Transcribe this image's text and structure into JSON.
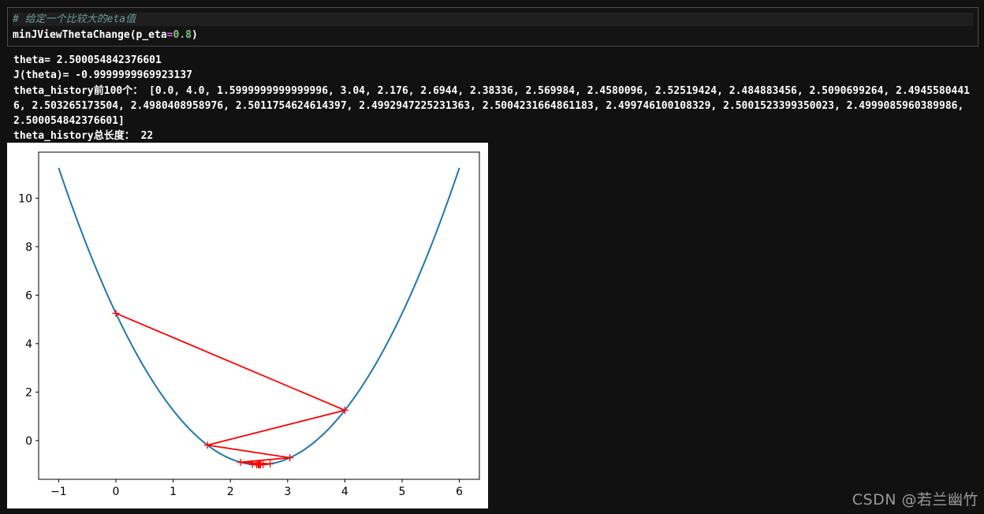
{
  "cell": {
    "comment": "# 给定一个比较大的eta值",
    "code_prefix": "minJViewThetaChange(p_eta",
    "code_operator": "=",
    "code_value": "0.8",
    "code_suffix": ")"
  },
  "output": {
    "theta_line": "theta= 2.500054842376601",
    "j_line": "J(theta)= -0.9999999969923137",
    "history_line": "theta_history前100个： [0.0, 4.0, 1.5999999999999996, 3.04, 2.176, 2.6944, 2.38336, 2.569984, 2.4580096, 2.52519424, 2.484883456, 2.5090699264, 2.49455804416, 2.503265173504, 2.4980408958976, 2.5011754624614397, 2.4992947225231363, 2.5004231664861183, 2.499746100108329, 2.5001523399350023, 2.4999085960389986, 2.500054842376601]",
    "length_line": "theta_history总长度： 22"
  },
  "chart_data": {
    "type": "line",
    "title": "",
    "xlabel": "",
    "ylabel": "",
    "xlim": [
      -1.35,
      6.35
    ],
    "ylim": [
      -1.6,
      11.9
    ],
    "xticks": [
      "−1",
      "0",
      "1",
      "2",
      "3",
      "4",
      "5",
      "6"
    ],
    "yticks": [
      "0",
      "2",
      "4",
      "6",
      "8",
      "10"
    ],
    "grid": false,
    "series": [
      {
        "kind": "curve",
        "function": "(x-2.5)^2 - 1",
        "x_range": [
          -1,
          6
        ],
        "color": "#1f77b4"
      },
      {
        "kind": "path",
        "color": "#ff0000",
        "marker": "+",
        "x": [
          0.0,
          4.0,
          1.5999999999999996,
          3.04,
          2.176,
          2.6944,
          2.38336,
          2.569984,
          2.4580096,
          2.52519424,
          2.484883456,
          2.5090699264,
          2.49455804416,
          2.503265173504,
          2.4980408958976,
          2.5011754624614397,
          2.4992947225231363,
          2.5004231664861183,
          2.499746100108329,
          2.5001523399350023,
          2.4999085960389986,
          2.500054842376601
        ]
      }
    ]
  },
  "watermark": "CSDN @若兰幽竹"
}
